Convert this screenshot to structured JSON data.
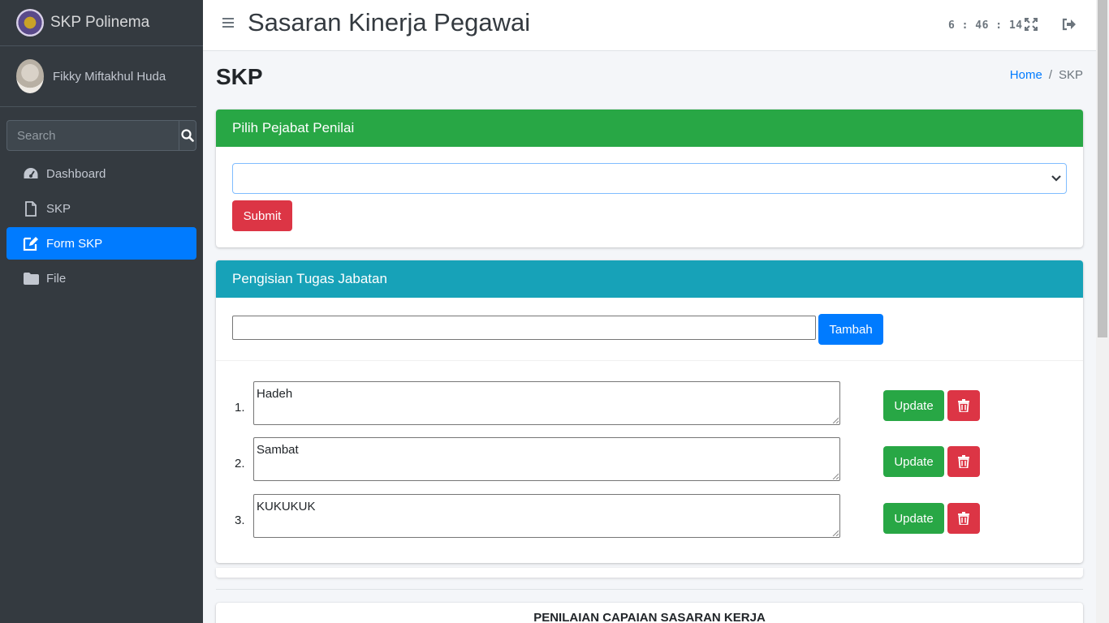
{
  "app": {
    "brand": "SKP Polinema",
    "header_title": "Sasaran Kinerja Pegawai",
    "clock": "6 : 46 : 14"
  },
  "user": {
    "name": "Fikky Miftakhul Huda"
  },
  "search": {
    "placeholder": "Search"
  },
  "sidebar": {
    "items": [
      {
        "label": "Dashboard",
        "icon": "tachometer-icon"
      },
      {
        "label": "SKP",
        "icon": "file-icon"
      },
      {
        "label": "Form SKP",
        "icon": "edit-icon",
        "active": true
      },
      {
        "label": "File",
        "icon": "folder-icon"
      }
    ]
  },
  "page": {
    "title": "SKP",
    "breadcrumb": {
      "home": "Home",
      "separator": "/",
      "current": "SKP"
    }
  },
  "pejabat": {
    "header": "Pilih Pejabat Penilai",
    "selected": "",
    "submit_label": "Submit"
  },
  "tugas": {
    "header": "Pengisian Tugas Jabatan",
    "input_value": "",
    "add_label": "Tambah",
    "update_label": "Update",
    "items": [
      {
        "num": "1.",
        "text": "Hadeh"
      },
      {
        "num": "2.",
        "text": "Sambat"
      },
      {
        "num": "3.",
        "text": "KUKUKUK"
      }
    ]
  },
  "penilaian": {
    "title": "PENILAIAN CAPAIAN SASARAN KERJA"
  },
  "colors": {
    "sidebar": "#343a40",
    "primary": "#007bff",
    "success": "#28a745",
    "danger": "#dc3545",
    "info": "#17a2b8"
  }
}
